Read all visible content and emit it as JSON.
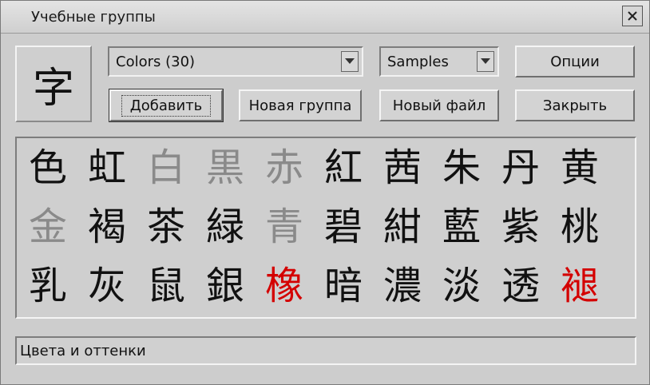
{
  "window": {
    "title": "Учебные группы",
    "close_glyph": "×"
  },
  "preview": {
    "char": "字"
  },
  "controls": {
    "group_select": {
      "value": "Colors (30)"
    },
    "source_select": {
      "value": "Samples"
    },
    "buttons": {
      "options": "Опции",
      "add": "Добавить",
      "new_group": "Новая группа",
      "new_file": "Новый файл",
      "close": "Закрыть"
    }
  },
  "kanji_rows": [
    [
      {
        "char": "色",
        "state": "normal"
      },
      {
        "char": "虹",
        "state": "normal"
      },
      {
        "char": "白",
        "state": "gray"
      },
      {
        "char": "黒",
        "state": "gray"
      },
      {
        "char": "赤",
        "state": "gray"
      },
      {
        "char": "紅",
        "state": "normal"
      },
      {
        "char": "茜",
        "state": "normal"
      },
      {
        "char": "朱",
        "state": "normal"
      },
      {
        "char": "丹",
        "state": "normal"
      },
      {
        "char": "黄",
        "state": "normal"
      }
    ],
    [
      {
        "char": "金",
        "state": "gray"
      },
      {
        "char": "褐",
        "state": "normal"
      },
      {
        "char": "茶",
        "state": "normal"
      },
      {
        "char": "緑",
        "state": "normal"
      },
      {
        "char": "青",
        "state": "gray"
      },
      {
        "char": "碧",
        "state": "normal"
      },
      {
        "char": "紺",
        "state": "normal"
      },
      {
        "char": "藍",
        "state": "normal"
      },
      {
        "char": "紫",
        "state": "normal"
      },
      {
        "char": "桃",
        "state": "normal"
      }
    ],
    [
      {
        "char": "乳",
        "state": "normal"
      },
      {
        "char": "灰",
        "state": "normal"
      },
      {
        "char": "鼠",
        "state": "normal"
      },
      {
        "char": "銀",
        "state": "normal"
      },
      {
        "char": "橡",
        "state": "red"
      },
      {
        "char": "暗",
        "state": "normal"
      },
      {
        "char": "濃",
        "state": "normal"
      },
      {
        "char": "淡",
        "state": "normal"
      },
      {
        "char": "透",
        "state": "normal"
      },
      {
        "char": "褪",
        "state": "red"
      }
    ]
  ],
  "status": {
    "text": "Цвета и оттенки"
  },
  "colors": {
    "normal": "#111111",
    "gray": "#8a8a8a",
    "red": "#d40000"
  }
}
